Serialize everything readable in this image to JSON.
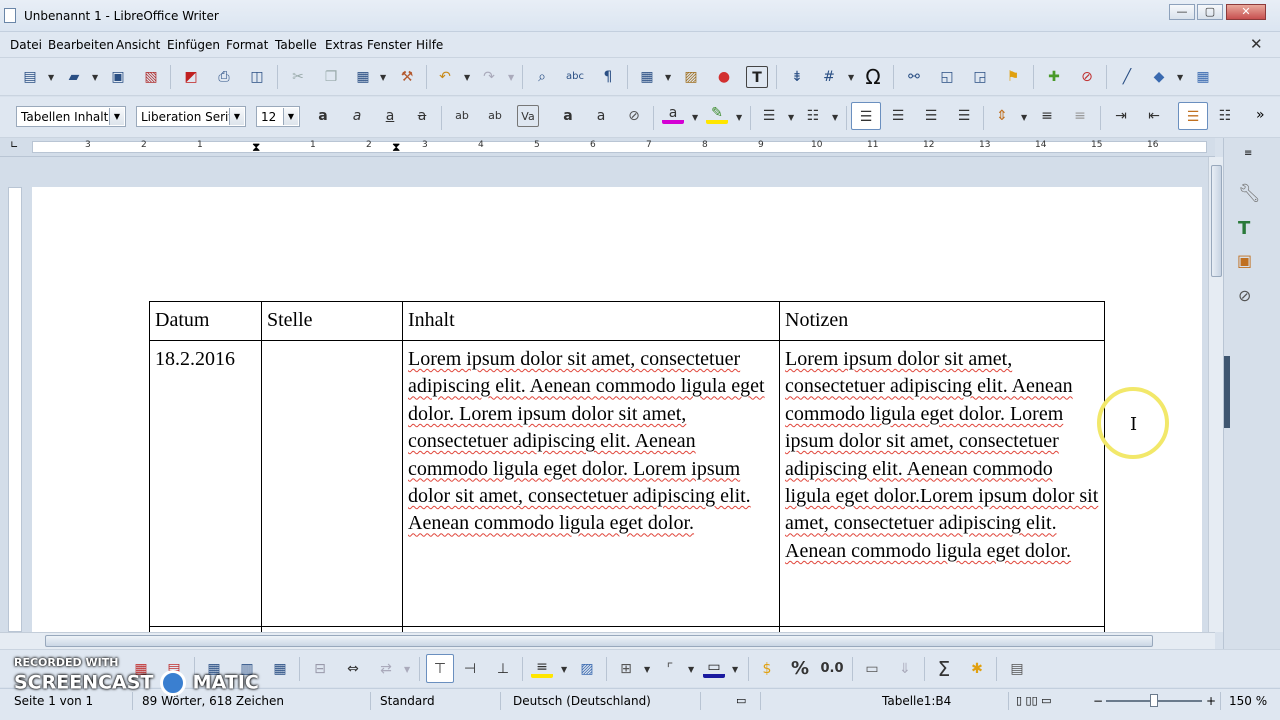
{
  "window": {
    "title": "Unbenannt 1 - LibreOffice Writer",
    "btn_min": "—",
    "btn_max": "▢",
    "btn_close": "✕",
    "close_doc": "✕"
  },
  "menu": [
    "Datei",
    "Bearbeiten",
    "Ansicht",
    "Einfügen",
    "Format",
    "Tabelle",
    "Extras",
    "Fenster",
    "Hilfe"
  ],
  "format_bar": {
    "style": "Tabellen Inhalt",
    "font": "Liberation Serif",
    "size": "12",
    "more": "»"
  },
  "ruler_numbers": [
    "3",
    "2",
    "1",
    "1",
    "2",
    "3",
    "4",
    "5",
    "6",
    "7",
    "8",
    "9",
    "10",
    "11",
    "12",
    "13",
    "14",
    "15",
    "16"
  ],
  "table": {
    "headers": [
      "Datum",
      "Stelle",
      "Inhalt",
      "Notizen"
    ],
    "rows": [
      [
        "18.2.2016",
        "",
        "Lorem ipsum dolor sit amet, consectetuer adipiscing elit. Aenean commodo ligula eget dolor. Lorem ipsum dolor sit amet, consectetuer adipiscing elit. Aenean commodo ligula eget dolor. Lorem ipsum dolor sit amet, consectetuer adipiscing elit. Aenean commodo ligula eget dolor.",
        "Lorem ipsum dolor sit amet, consectetuer adipiscing elit. Aenean commodo ligula eget dolor. Lorem ipsum dolor sit amet, consectetuer adipiscing elit. Aenean commodo ligula eget dolor.Lorem ipsum dolor sit amet, consectetuer adipiscing elit. Aenean commodo ligula eget dolor."
      ]
    ]
  },
  "table_toolbar": {
    "percent": "%",
    "decimal": "0.0",
    "sum": "Σ"
  },
  "status": {
    "page": "Seite 1 von 1",
    "words": "89 Wörter, 618 Zeichen",
    "page_style": "Standard",
    "language": "Deutsch (Deutschland)",
    "cell": "Tabelle1:B4",
    "zoom": "150 %",
    "zoom_minus": "−",
    "zoom_plus": "+"
  },
  "watermark": {
    "line1": "RECORDED WITH",
    "line2": "SCREENCAST",
    "line3": "MATIC"
  },
  "colors": {
    "accent": "#2a4f84",
    "spell_underline": "#e0453a",
    "font_color": "#d400d4",
    "highlight": "#ffe600"
  }
}
